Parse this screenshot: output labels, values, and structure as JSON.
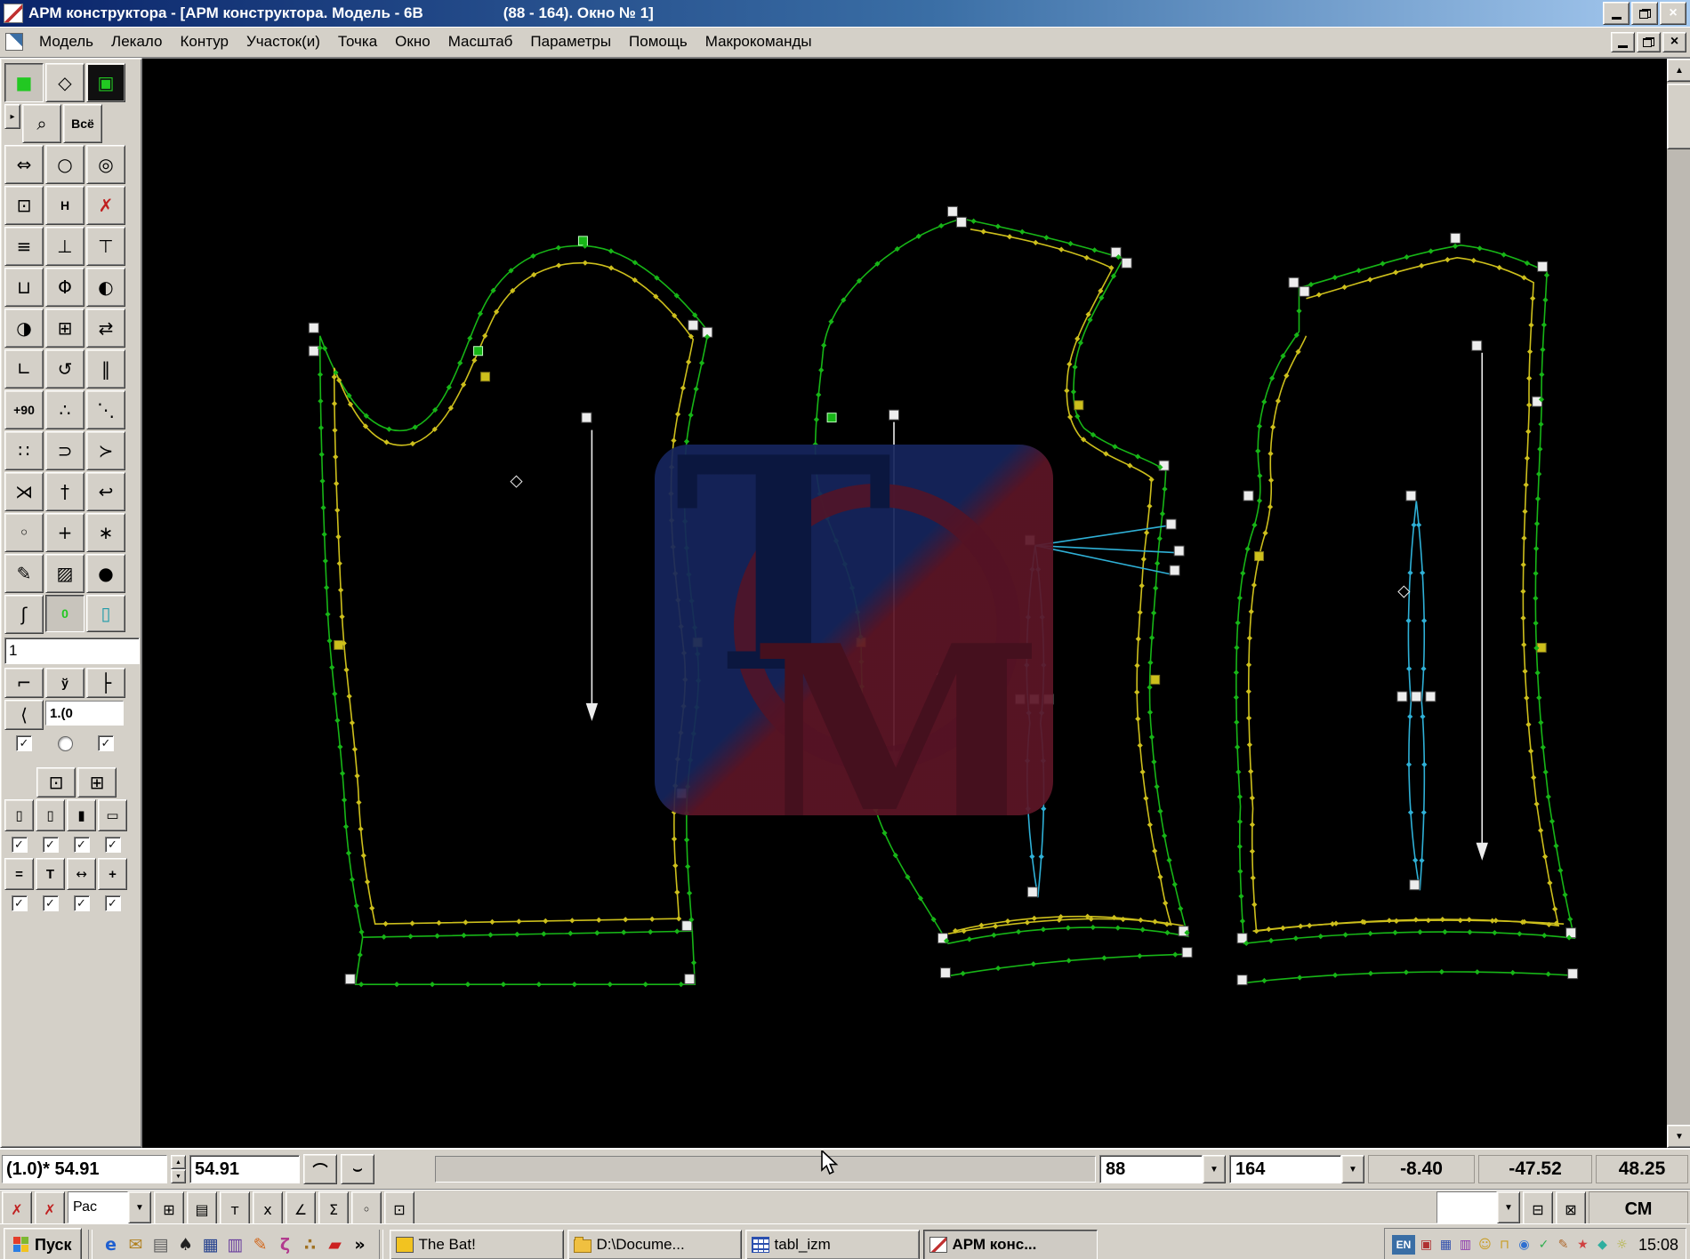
{
  "titlebar": {
    "title_left": "АРМ конструктора - [АРМ конструктора. Модель - 6В",
    "title_right": "(88 - 164). Окно № 1]"
  },
  "menu": {
    "items": [
      {
        "id": "model",
        "label": "Модель"
      },
      {
        "id": "lekalo",
        "label": "Лекало"
      },
      {
        "id": "kontur",
        "label": "Контур"
      },
      {
        "id": "uchastok",
        "label": "Участок(и)"
      },
      {
        "id": "tochka",
        "label": "Точка"
      },
      {
        "id": "okno",
        "label": "Окно"
      },
      {
        "id": "masshtab",
        "label": "Масштаб"
      },
      {
        "id": "parametry",
        "label": "Параметры"
      },
      {
        "id": "pomosch",
        "label": "Помощь"
      },
      {
        "id": "makrokomandy",
        "label": "Макрокоманды"
      }
    ]
  },
  "toolbox": {
    "items": [
      {
        "id": "select-mode",
        "type": "btn",
        "glyph": "■",
        "cls": "dark pressed"
      },
      {
        "id": "diamond-mode",
        "type": "btn",
        "glyph": "◇"
      },
      {
        "id": "layers-mode",
        "type": "btn",
        "glyph": "▣",
        "cls": "dark"
      },
      {
        "id": "expand-arrow",
        "type": "tiny",
        "glyph": "▸"
      },
      {
        "id": "zoom",
        "type": "btn",
        "glyph": "⌕"
      },
      {
        "id": "zoom-all",
        "type": "btn",
        "glyph": "Всё",
        "cls": "txt"
      },
      {
        "id": "stretch-horizontal",
        "type": "btn",
        "glyph": "⇔"
      },
      {
        "id": "ellipse",
        "type": "btn",
        "glyph": "○"
      },
      {
        "id": "circle-handles",
        "type": "btn",
        "glyph": "◎"
      },
      {
        "id": "rect-frame",
        "type": "btn",
        "glyph": "⊡"
      },
      {
        "id": "h-tool",
        "type": "btn",
        "glyph": "H",
        "cls": "txt"
      },
      {
        "id": "delete",
        "type": "btn",
        "glyph": "✗",
        "cls": "red"
      },
      {
        "id": "list",
        "type": "btn",
        "glyph": "≡"
      },
      {
        "id": "piece-up",
        "type": "btn",
        "glyph": "⊥"
      },
      {
        "id": "piece-down",
        "type": "btn",
        "glyph": "⊤"
      },
      {
        "id": "piece-cut",
        "type": "btn",
        "glyph": "⊔"
      },
      {
        "id": "symmetry",
        "type": "btn",
        "glyph": "Φ"
      },
      {
        "id": "mirror-left",
        "type": "btn",
        "glyph": "◐"
      },
      {
        "id": "mirror-right",
        "type": "btn",
        "glyph": "◑"
      },
      {
        "id": "copy",
        "type": "btn",
        "glyph": "⊞"
      },
      {
        "id": "swap",
        "type": "btn",
        "glyph": "⇄"
      },
      {
        "id": "corner",
        "type": "btn",
        "glyph": "∟"
      },
      {
        "id": "rotate",
        "type": "btn",
        "glyph": "↺"
      },
      {
        "id": "pause",
        "type": "btn",
        "glyph": "‖"
      },
      {
        "id": "rotate-90",
        "type": "btn",
        "glyph": "+90",
        "cls": "txt"
      },
      {
        "id": "nodes-chain",
        "type": "btn",
        "glyph": "∴"
      },
      {
        "id": "node-line",
        "type": "btn",
        "glyph": "⋱"
      },
      {
        "id": "nodes-box",
        "type": "btn",
        "glyph": "∷"
      },
      {
        "id": "curve-open",
        "type": "btn",
        "glyph": "⊃"
      },
      {
        "id": "curve-tangent",
        "type": "btn",
        "glyph": "≻"
      },
      {
        "id": "curve-cross",
        "type": "btn",
        "glyph": "⋊"
      },
      {
        "id": "pin",
        "type": "btn",
        "glyph": "†"
      },
      {
        "id": "undo-curve",
        "type": "btn",
        "glyph": "↩"
      },
      {
        "id": "point-corner",
        "type": "btn",
        "glyph": "◦"
      },
      {
        "id": "move",
        "type": "btn",
        "glyph": "+"
      },
      {
        "id": "distribute",
        "type": "btn",
        "glyph": "∗"
      },
      {
        "id": "pencil",
        "type": "btn",
        "glyph": "✎"
      },
      {
        "id": "hatch",
        "type": "btn",
        "glyph": "▨"
      },
      {
        "id": "point",
        "type": "btn",
        "glyph": "●"
      },
      {
        "id": "stroke",
        "type": "btn",
        "glyph": "ʃ"
      },
      {
        "id": "toggle-contour",
        "type": "toggle",
        "glyph": "0",
        "cls": "dark pressed txt"
      },
      {
        "id": "toggle-piece",
        "type": "toggle",
        "glyph": "▯",
        "cls": "teal"
      },
      {
        "id": "layer-number",
        "type": "input",
        "value": "1"
      },
      {
        "id": "measure",
        "type": "btn",
        "glyph": "⌐",
        "cls": "sm"
      },
      {
        "id": "y-mark",
        "type": "btn",
        "glyph": "ў",
        "cls": "sm txt"
      },
      {
        "id": "branch",
        "type": "btn",
        "glyph": "├",
        "cls": "sm"
      },
      {
        "id": "bracket",
        "type": "btn",
        "glyph": "⟨",
        "cls": "sm"
      },
      {
        "id": "scale-label",
        "type": "label",
        "label": "1.(0"
      },
      {
        "id": "opt-a",
        "type": "check",
        "on": true
      },
      {
        "id": "opt-b",
        "type": "radio",
        "on": false
      },
      {
        "id": "opt-c",
        "type": "check",
        "on": true
      },
      {
        "id": "gap-1",
        "type": "gap"
      },
      {
        "id": "pad-1",
        "type": "pad"
      },
      {
        "id": "door-a",
        "type": "btn",
        "glyph": "⊡",
        "cls": "sm"
      },
      {
        "id": "door-b",
        "type": "btn",
        "glyph": "⊞",
        "cls": "sm"
      },
      {
        "id": "card-1",
        "type": "btn",
        "glyph": "▯",
        "cls": "nr"
      },
      {
        "id": "card-2",
        "type": "btn",
        "glyph": "▯",
        "cls": "nr"
      },
      {
        "id": "card-3",
        "type": "btn",
        "glyph": "▮",
        "cls": "nr"
      },
      {
        "id": "card-4",
        "type": "btn",
        "glyph": "▭",
        "cls": "nr"
      },
      {
        "id": "flag-1",
        "type": "check",
        "on": true,
        "cls": "q"
      },
      {
        "id": "flag-2",
        "type": "check",
        "on": true,
        "cls": "q"
      },
      {
        "id": "flag-3",
        "type": "check",
        "on": true,
        "cls": "q"
      },
      {
        "id": "flag-4",
        "type": "check",
        "on": true,
        "cls": "q"
      },
      {
        "id": "equal",
        "type": "btn",
        "glyph": "=",
        "cls": "nr txt"
      },
      {
        "id": "t-tool",
        "type": "btn",
        "glyph": "T",
        "cls": "nr txt"
      },
      {
        "id": "arrow-e",
        "type": "btn",
        "glyph": "↔",
        "cls": "nr"
      },
      {
        "id": "plus",
        "type": "btn",
        "glyph": "+",
        "cls": "nr txt"
      },
      {
        "id": "flag-5",
        "type": "check",
        "on": true,
        "cls": "q"
      },
      {
        "id": "flag-6",
        "type": "check",
        "on": true,
        "cls": "q"
      },
      {
        "id": "flag-7",
        "type": "check",
        "on": true,
        "cls": "q"
      },
      {
        "id": "flag-8",
        "type": "check",
        "on": true,
        "cls": "q"
      }
    ]
  },
  "canvas": {
    "colors": {
      "outline": "#17b517",
      "inner": "#cdbf1c",
      "dart": "#2fb0d6",
      "handle": "#ededed",
      "background": "#000000"
    },
    "watermark": {
      "t": "T",
      "m": "M"
    }
  },
  "status": {
    "zoom_display": "(1.0)* 54.91",
    "value_input": "54.91",
    "size": "88",
    "height": "164",
    "dx": "-8.40",
    "dy": "-47.52",
    "dist": "48.25",
    "units": "СМ",
    "row2": [
      {
        "id": "delete-a",
        "type": "btn",
        "glyph": "✗",
        "color": "#c02020"
      },
      {
        "id": "delete-b",
        "type": "btn",
        "glyph": "✗",
        "color": "#c02020"
      },
      {
        "id": "view-combo",
        "type": "combo",
        "value": "Рас"
      },
      {
        "id": "grid",
        "type": "btn",
        "glyph": "⊞"
      },
      {
        "id": "sheet",
        "type": "btn",
        "glyph": "▤"
      },
      {
        "id": "text-t",
        "type": "btn",
        "glyph": "т"
      },
      {
        "id": "text-x",
        "type": "btn",
        "glyph": "х"
      },
      {
        "id": "angle",
        "type": "btn",
        "glyph": "∠"
      },
      {
        "id": "sum",
        "type": "btn",
        "glyph": "Σ"
      },
      {
        "id": "node",
        "type": "btn",
        "glyph": "◦"
      },
      {
        "id": "link",
        "type": "btn",
        "glyph": "⊡"
      },
      {
        "id": "spacer",
        "type": "flex"
      },
      {
        "id": "sel-combo",
        "type": "combo",
        "value": ""
      },
      {
        "id": "win-split",
        "type": "btn",
        "glyph": "⊟"
      },
      {
        "id": "win-new",
        "type": "btn",
        "glyph": "⊠"
      },
      {
        "id": "units-cell",
        "type": "cell"
      }
    ]
  },
  "taskbar": {
    "start": "Пуск",
    "quicklaunch": [
      {
        "id": "ie",
        "glyph": "e",
        "color": "#1f5fd0"
      },
      {
        "id": "mail",
        "glyph": "✉",
        "color": "#b08020"
      },
      {
        "id": "desktop",
        "glyph": "▤",
        "color": "#606060"
      },
      {
        "id": "thebat",
        "glyph": "♠",
        "color": "#222222"
      },
      {
        "id": "floppy",
        "glyph": "▦",
        "color": "#24408e"
      },
      {
        "id": "archive",
        "glyph": "▥",
        "color": "#6a3f9e"
      },
      {
        "id": "pen",
        "glyph": "✎",
        "color": "#d2691e"
      },
      {
        "id": "brush",
        "glyph": "ζ",
        "color": "#b23a8e"
      },
      {
        "id": "paw",
        "glyph": "∴",
        "color": "#a07020"
      },
      {
        "id": "car",
        "glyph": "▰",
        "color": "#cc2020"
      },
      {
        "id": "more",
        "glyph": "»",
        "color": "#000000"
      }
    ],
    "tasks": [
      {
        "id": "thebat",
        "icon": "bat",
        "label": "The Bat!",
        "active": false
      },
      {
        "id": "explorer-d",
        "icon": "folder",
        "label": "D:\\Docume...",
        "active": false
      },
      {
        "id": "tabl-izm",
        "icon": "table",
        "label": "tabl_izm",
        "active": false
      },
      {
        "id": "arm-constructor",
        "icon": "pattern",
        "label": "АРМ конс...",
        "active": true
      }
    ],
    "language": "EN",
    "tray": [
      {
        "id": "monitor",
        "glyph": "▣",
        "color": "#b03030"
      },
      {
        "id": "grid",
        "glyph": "▦",
        "color": "#2f4fae"
      },
      {
        "id": "layers",
        "glyph": "▥",
        "color": "#8a2fae"
      },
      {
        "id": "smiley",
        "glyph": "☺",
        "color": "#c89b1e"
      },
      {
        "id": "lock",
        "glyph": "⊓",
        "color": "#c89b1e"
      },
      {
        "id": "ball",
        "glyph": "◉",
        "color": "#2f6fd0"
      },
      {
        "id": "check",
        "glyph": "✓",
        "color": "#2fae4f"
      },
      {
        "id": "pen",
        "glyph": "✎",
        "color": "#b06a2f"
      },
      {
        "id": "star",
        "glyph": "★",
        "color": "#d04040"
      },
      {
        "id": "cube",
        "glyph": "◆",
        "color": "#2fae9f"
      },
      {
        "id": "sun",
        "glyph": "☼",
        "color": "#b0b030"
      }
    ],
    "clock": "15:08"
  }
}
